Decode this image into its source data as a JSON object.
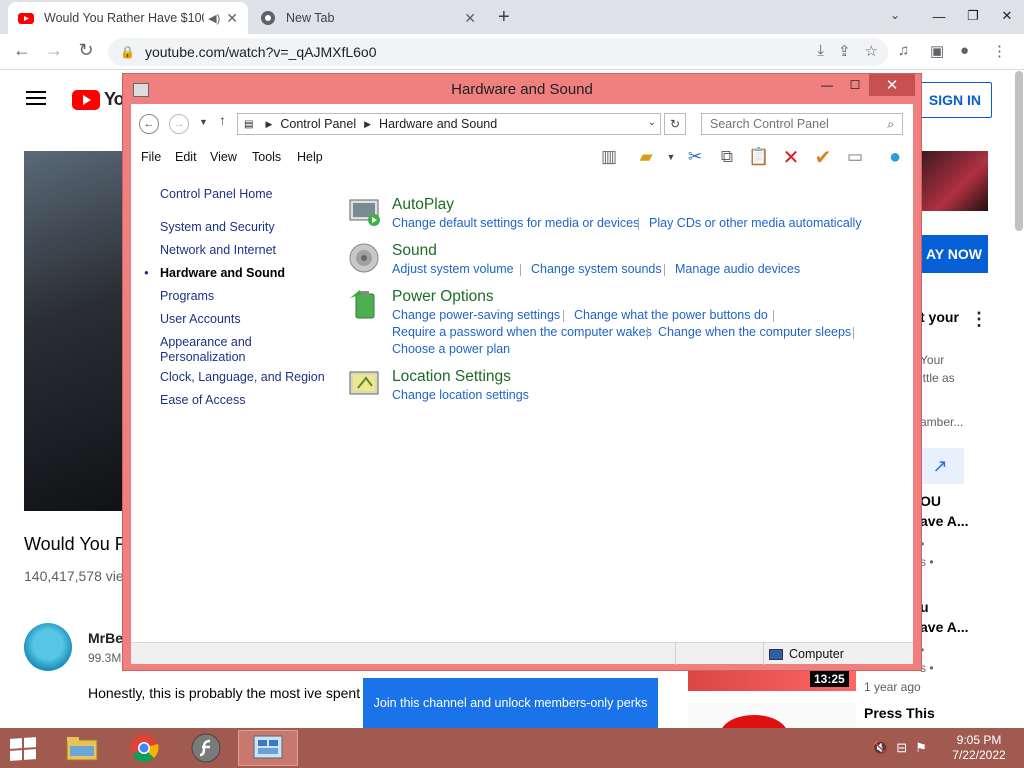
{
  "browser": {
    "tabs": [
      {
        "title": "Would You Rather Have $100",
        "favicon": "youtube-icon",
        "active": true
      },
      {
        "title": "New Tab",
        "favicon": "chrome-icon",
        "active": false
      }
    ],
    "url": "youtube.com/watch?v=_qAJMXfL6o0"
  },
  "youtube": {
    "logo_text": "Yo",
    "sign_in": "SIGN IN",
    "video_title": "Would You R",
    "views": "140,417,578 vie",
    "channel_name": "MrBe",
    "subscribers": "99.3M",
    "description": "Honestly, this is probably the most ive spent",
    "join_banner": "Join this channel and unlock members-only perks",
    "ad_button": "AY NOW",
    "side_items": {
      "promo_title": "t your",
      "promo_line1": "Your",
      "promo_line2": "ittle as",
      "promo_line3": "amber...",
      "rec1_line1": "OU",
      "rec1_line2": "ave A...",
      "rec1_meta1": "•",
      "rec1_meta2": "s •",
      "rec2_line1": "u",
      "rec2_line2": "ave A...",
      "rec2_meta1": "•",
      "rec2_meta2": "s •",
      "duration": "13:25",
      "rec2_age": "1 year ago",
      "rec3_title": "Press This"
    }
  },
  "control_panel": {
    "window_title": "Hardware and Sound",
    "breadcrumb": [
      "Control Panel",
      "Hardware and Sound"
    ],
    "search_placeholder": "Search Control Panel",
    "menu": [
      "File",
      "Edit",
      "View",
      "Tools",
      "Help"
    ],
    "left_nav": {
      "home": "Control Panel Home",
      "items": [
        {
          "label": "System and Security"
        },
        {
          "label": "Network and Internet"
        },
        {
          "label": "Hardware and Sound",
          "current": true
        },
        {
          "label": "Programs"
        },
        {
          "label": "User Accounts"
        },
        {
          "label": "Appearance and Personalization"
        },
        {
          "label": "Clock, Language, and Region"
        },
        {
          "label": "Ease of Access"
        }
      ]
    },
    "categories": [
      {
        "title": "AutoPlay",
        "icon": "autoplay-icon",
        "tasks": [
          "Change default settings for media or devices",
          "Play CDs or other media automatically"
        ]
      },
      {
        "title": "Sound",
        "icon": "speaker-icon",
        "tasks": [
          "Adjust system volume",
          "Change system sounds",
          "Manage audio devices"
        ]
      },
      {
        "title": "Power Options",
        "icon": "battery-icon",
        "tasks": [
          "Change power-saving settings",
          "Change what the power buttons do",
          "Require a password when the computer wakes",
          "Change when the computer sleeps",
          "Choose a power plan"
        ]
      },
      {
        "title": "Location Settings",
        "icon": "location-icon",
        "tasks": [
          "Change location settings"
        ]
      }
    ],
    "status": "Computer",
    "colors": {
      "title_bar": "#f08080",
      "link": "#1e64c8",
      "category": "#1e6b24"
    }
  },
  "taskbar": {
    "apps": [
      "file-explorer-icon",
      "chrome-icon",
      "flash-icon",
      "control-panel-icon"
    ],
    "time": "9:05 PM",
    "date": "7/22/2022"
  }
}
